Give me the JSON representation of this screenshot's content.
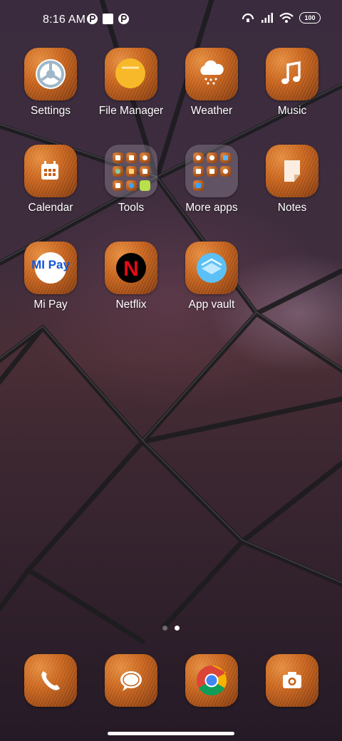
{
  "status_bar": {
    "time": "8:16 AM",
    "battery": "100",
    "icons": [
      "notification-app-icon",
      "square-notification-icon",
      "notification-app-icon-2",
      "hotspot-icon",
      "signal-icon",
      "wifi-icon",
      "battery-icon"
    ]
  },
  "apps": {
    "settings": "Settings",
    "file_manager": "File Manager",
    "weather": "Weather",
    "music": "Music",
    "calendar": "Calendar",
    "tools": "Tools",
    "more_apps": "More apps",
    "notes": "Notes",
    "mi_pay": "Mi Pay",
    "netflix": "Netflix",
    "app_vault": "App vault"
  },
  "mipay_logo_text": "MI Pay",
  "netflix_logo_text": "N",
  "pager": {
    "pages": 2,
    "current": 2
  },
  "dock": [
    "phone-icon",
    "messages-icon",
    "chrome-icon",
    "camera-icon"
  ],
  "colors": {
    "icon_wood": "#c55f19",
    "accent_white": "#ffffff"
  }
}
